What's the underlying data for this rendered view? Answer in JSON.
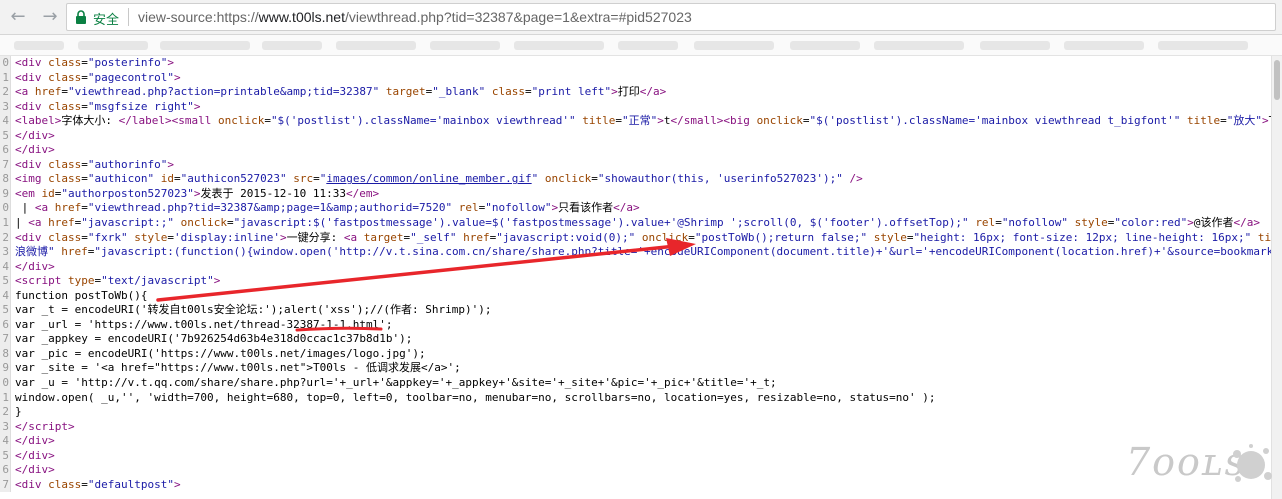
{
  "browser": {
    "back_icon": "back-arrow-icon",
    "forward_icon": "forward-arrow-icon",
    "reload_icon": "reload-icon",
    "reload_glyph": "C",
    "back_glyph": "←",
    "forward_glyph": "→",
    "security_label": "安全",
    "url_scheme": "view-source:https://",
    "url_host": "www.t00ls.net",
    "url_path": "/viewthread.php?tid=32387&page=1&extra=#pid527023"
  },
  "source_lines": [
    {
      "n": "0",
      "html": "<span class='tag'>&lt;div</span> <span class='attr'>class</span>=<span class='val'>\"posterinfo\"</span><span class='tag'>&gt;</span>"
    },
    {
      "n": "1",
      "html": "<span class='tag'>&lt;div</span> <span class='attr'>class</span>=<span class='val'>\"pagecontrol\"</span><span class='tag'>&gt;</span>"
    },
    {
      "n": "2",
      "html": "<span class='tag'>&lt;a</span> <span class='attr'>href</span>=<span class='val'>\"viewthread.php?action=printable&amp;amp;tid=32387\"</span> <span class='attr'>target</span>=<span class='val'>\"_blank\"</span> <span class='attr'>class</span>=<span class='val'>\"print left\"</span><span class='tag'>&gt;</span>打印<span class='tag'>&lt;/a&gt;</span>"
    },
    {
      "n": "3",
      "html": "<span class='tag'>&lt;div</span> <span class='attr'>class</span>=<span class='val'>\"msgfsize right\"</span><span class='tag'>&gt;</span>"
    },
    {
      "n": "4",
      "html": "<span class='tag'>&lt;label&gt;</span>字体大小: <span class='tag'>&lt;/label&gt;&lt;small</span> <span class='attr'>onclick</span>=<span class='val'>\"$('postlist').className='mainbox viewthread'\"</span> <span class='attr'>title</span>=<span class='val'>\"正常\"</span><span class='tag'>&gt;</span>t<span class='tag'>&lt;/small&gt;&lt;big</span> <span class='attr'>onclick</span>=<span class='val'>\"$('postlist').className='mainbox viewthread t_bigfont'\"</span> <span class='attr'>title</span>=<span class='val'>\"放大\"</span><span class='tag'>&gt;</span>T<span class='tag'>&lt;/</span>"
    },
    {
      "n": "5",
      "html": "<span class='tag'>&lt;/div&gt;</span>"
    },
    {
      "n": "6",
      "html": "<span class='tag'>&lt;/div&gt;</span>"
    },
    {
      "n": "7",
      "html": "<span class='tag'>&lt;div</span> <span class='attr'>class</span>=<span class='val'>\"authorinfo\"</span><span class='tag'>&gt;</span>"
    },
    {
      "n": "8",
      "html": "<span class='tag'>&lt;img</span> <span class='attr'>class</span>=<span class='val'>\"authicon\"</span> <span class='attr'>id</span>=<span class='val'>\"authicon527023\"</span> <span class='attr'>src</span>=<span class='val'>\"<span class='lnk'>images/common/online_member.gif</span>\"</span> <span class='attr'>onclick</span>=<span class='val'>\"showauthor(this, 'userinfo527023');\"</span> <span class='tag'>/&gt;</span>"
    },
    {
      "n": "9",
      "html": "<span class='tag'>&lt;em</span> <span class='attr'>id</span>=<span class='val'>\"authorposton527023\"</span><span class='tag'>&gt;</span>发表于 2015-12-10 11:33<span class='tag'>&lt;/em&gt;</span>"
    },
    {
      "n": "0",
      "html": " | <span class='tag'>&lt;a</span> <span class='attr'>href</span>=<span class='val'>\"viewthread.php?tid=32387&amp;amp;page=1&amp;amp;authorid=7520\"</span> <span class='attr'>rel</span>=<span class='val'>\"nofollow\"</span><span class='tag'>&gt;</span>只看该作者<span class='tag'>&lt;/a&gt;</span>"
    },
    {
      "n": "1",
      "html": "| <span class='tag'>&lt;a</span> <span class='attr'>href</span>=<span class='val'>\"javascript:;\"</span> <span class='attr'>onclick</span>=<span class='val'>\"javascript:$('fastpostmessage').value=$('fastpostmessage').value+'@Shrimp ';scroll(0, $('footer').offsetTop);\"</span> <span class='attr'>rel</span>=<span class='val'>\"nofollow\"</span> <span class='attr'>style</span>=<span class='val'>\"color:red\"</span><span class='tag'>&gt;</span>@该作者<span class='tag'>&lt;/a&gt;</span>"
    },
    {
      "n": "2",
      "html": "<span class='tag'>&lt;div</span> <span class='attr'>class</span>=<span class='val'>\"fxrk\"</span> <span class='attr'>style</span>=<span class='val'>'display:inline'</span><span class='tag'>&gt;</span>一键分享: <span class='tag'>&lt;a</span> <span class='attr'>target</span>=<span class='val'>\"_self\"</span> <span class='attr'>href</span>=<span class='val'>\"javascript:void(0);\"</span> <span class='attr'>onclick</span>=<span class='val'>\"postToWb();return false;\"</span> <span class='attr'>style</span>=<span class='val'>\"height: 16px; font-size: 12px; line-height: 16px;\"</span> <span class='attr'>title</span>=<span class='val'>\"</span>"
    },
    {
      "n": "3",
      "html": "<span class='val'>浪微博\"</span> <span class='attr'>href</span>=<span class='val'>\"javascript:(function(){window.open('http://v.t.sina.com.cn/share/share.php?title='+encodeURIComponent(document.title)+'&amp;url='+encodeURIComponent(location.href)+'&amp;source=bookmark','_</span>"
    },
    {
      "n": "4",
      "html": "<span class='tag'>&lt;/div&gt;</span>"
    },
    {
      "n": "5",
      "html": "<span class='tag'>&lt;script</span> <span class='attr'>type</span>=<span class='val'>\"text/javascript\"</span><span class='tag'>&gt;</span>"
    },
    {
      "n": "4",
      "html": "function postToWb(){"
    },
    {
      "n": "5",
      "html": "var _t = encodeURI('转发自t00ls安全论坛:');alert('xss');//(作者: Shrimp)');"
    },
    {
      "n": "6",
      "html": "var _url = 'https://www.t00ls.net/thread-32387-1-1.html';"
    },
    {
      "n": "7",
      "html": "var _appkey = encodeURI('7b926254d63b4e318d0ccac1c37b8d1b');"
    },
    {
      "n": "8",
      "html": "var _pic = encodeURI('https://www.t00ls.net/images/logo.jpg');"
    },
    {
      "n": "9",
      "html": "var _site = '&lt;a href=\"https://www.t00ls.net\"&gt;T00ls - 低调求发展&lt;/a&gt;';"
    },
    {
      "n": "0",
      "html": "var _u = 'http://v.t.qq.com/share/share.php?url='+_url+'&amp;appkey='+_appkey+'&amp;site='+_site+'&amp;pic='+_pic+'&amp;title='+_t;"
    },
    {
      "n": "1",
      "html": "window.open( _u,'', 'width=700, height=680, top=0, left=0, toolbar=no, menubar=no, scrollbars=no, location=yes, resizable=no, status=no' );"
    },
    {
      "n": "2",
      "html": "}"
    },
    {
      "n": "3",
      "html": "<span class='tag'>&lt;/script&gt;</span>"
    },
    {
      "n": "4",
      "html": "<span class='tag'>&lt;/div&gt;</span>"
    },
    {
      "n": "5",
      "html": "<span class='tag'>&lt;/div&gt;</span>"
    },
    {
      "n": "6",
      "html": "<span class='tag'>&lt;/div&gt;</span>"
    },
    {
      "n": "7",
      "html": "<span class='tag'>&lt;div</span> <span class='attr'>class</span>=<span class='val'>\"defaultpost\"</span><span class='tag'>&gt;</span>"
    }
  ],
  "watermark": "7ooʟs",
  "colors": {
    "annotation": "#e8262b",
    "tag": "#881280",
    "attr": "#994500",
    "value": "#1a1aa6"
  }
}
